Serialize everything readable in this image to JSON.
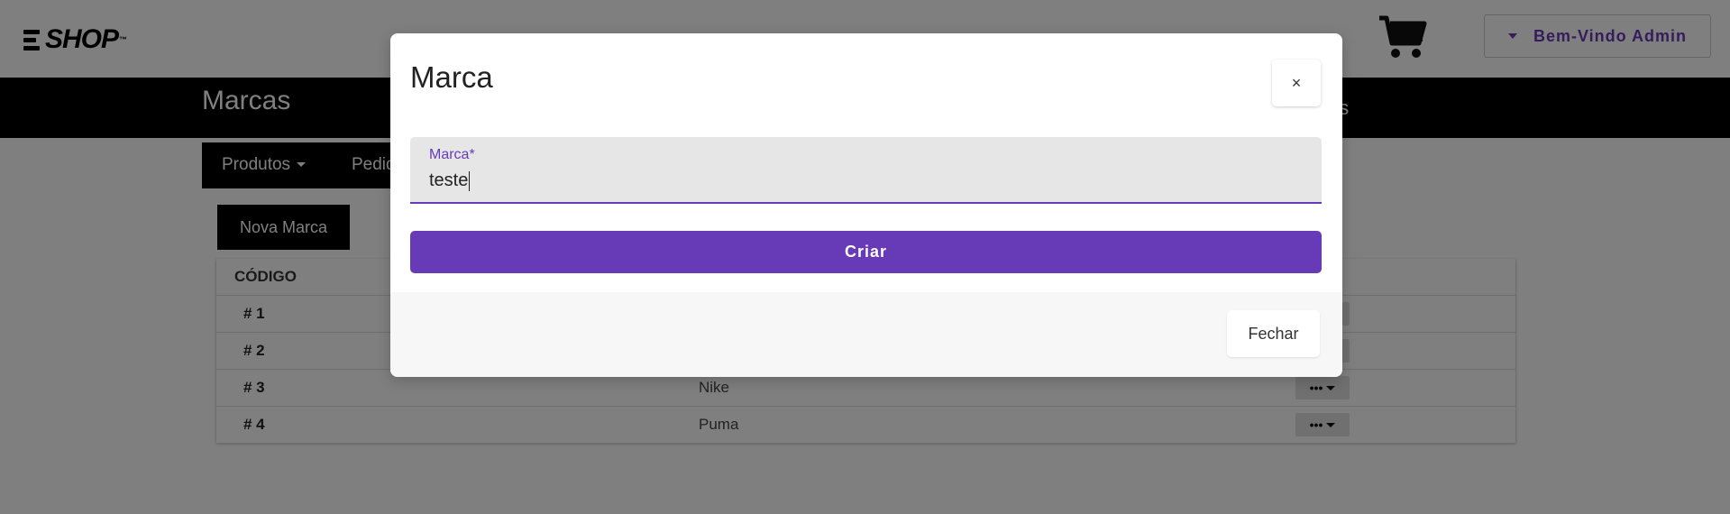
{
  "header": {
    "logo_text": "SHOP",
    "logo_tm": "™",
    "welcome_label": "Bem-Vindo Admin"
  },
  "titlebar": {
    "page_title": "Marcas",
    "right_text": "cas"
  },
  "menu": {
    "products_label": "Produtos",
    "orders_label": "Pedid"
  },
  "new_button_label": "Nova Marca",
  "table": {
    "header_code": "CÓDIGO",
    "rows": [
      {
        "code": "# 1",
        "name": ""
      },
      {
        "code": "# 2",
        "name": ""
      },
      {
        "code": "# 3",
        "name": "Nike"
      },
      {
        "code": "# 4",
        "name": "Puma"
      }
    ],
    "actions_glyph": "•••"
  },
  "modal": {
    "title": "Marca",
    "close_symbol": "×",
    "field_label": "Marca*",
    "field_value": "teste",
    "create_label": "Criar",
    "footer_close_label": "Fechar"
  },
  "colors": {
    "accent": "#673ab7",
    "dark": "#000000",
    "backdrop": "rgba(0,0,0,0.5)"
  },
  "icons": [
    "logo-mark-icon",
    "cart-icon",
    "caret-down-icon",
    "close-icon"
  ]
}
